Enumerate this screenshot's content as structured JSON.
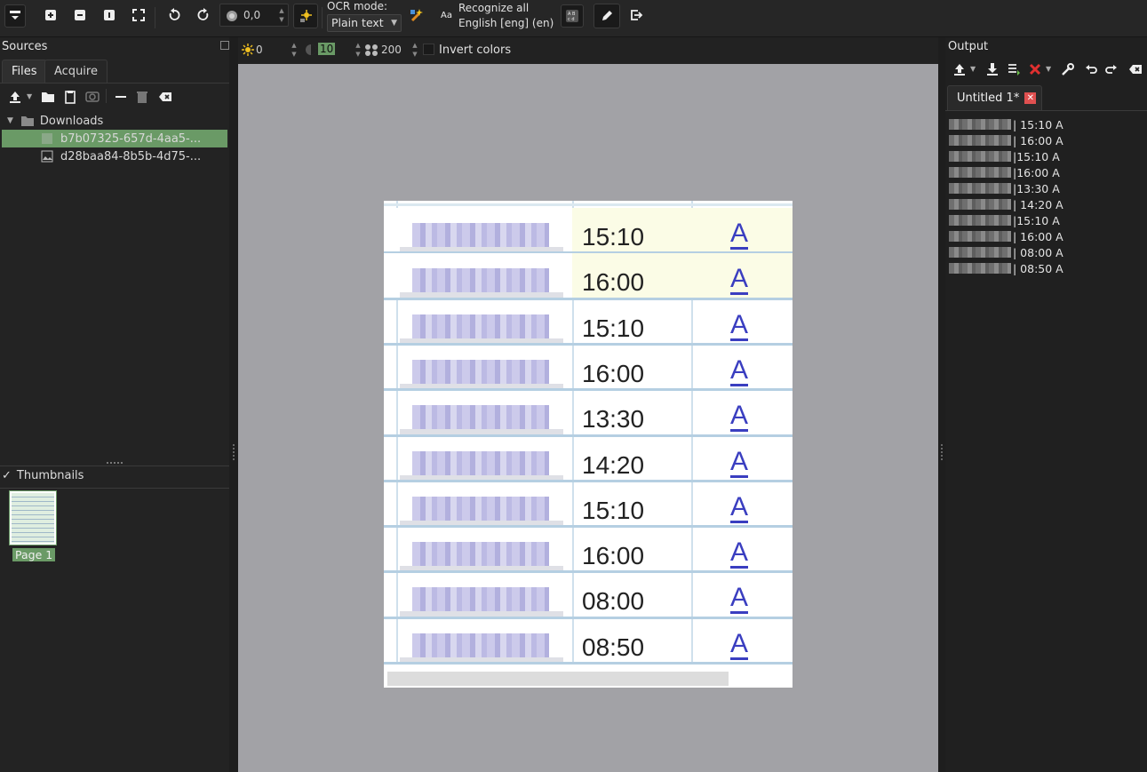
{
  "toolbar": {
    "rotation_value": "0,0",
    "ocr_mode_label": "OCR mode:",
    "ocr_mode_value": "Plain text",
    "recognize_label_line1": "Recognize all",
    "recognize_label_line2": "English [eng] (en)"
  },
  "sources": {
    "title": "Sources",
    "tabs": [
      "Files",
      "Acquire"
    ],
    "folder": "Downloads",
    "files": [
      "b7b07325-657d-4aa5-...",
      "d28baa84-8b5b-4d75-..."
    ],
    "thumbnails_label": "Thumbnails",
    "thumbnail_page": "Page 1"
  },
  "image_controls": {
    "brightness": "0",
    "contrast": "10",
    "resolution": "200",
    "invert_label": "Invert colors"
  },
  "document": {
    "rows": [
      {
        "time": "15:10",
        "mark": "A"
      },
      {
        "time": "16:00",
        "mark": "A"
      },
      {
        "time": "15:10",
        "mark": "A"
      },
      {
        "time": "16:00",
        "mark": "A"
      },
      {
        "time": "13:30",
        "mark": "A"
      },
      {
        "time": "14:20",
        "mark": "A"
      },
      {
        "time": "15:10",
        "mark": "A"
      },
      {
        "time": "16:00",
        "mark": "A"
      },
      {
        "time": "08:00",
        "mark": "A"
      },
      {
        "time": "08:50",
        "mark": "A"
      }
    ]
  },
  "output": {
    "title": "Output",
    "tab_label": "Untitled 1*",
    "lines": [
      "| 15:10 A",
      "| 16:00 A",
      "|15:10 A",
      "|16:00 A",
      "|13:30 A",
      "| 14:20 A",
      "|15:10 A",
      "| 16:00 A",
      "| 08:00 A",
      "| 08:50 A"
    ]
  },
  "colors": {
    "selection": "#6a9a66",
    "canvas_bg": "#a2a2a6",
    "close_tab": "#e05050"
  }
}
